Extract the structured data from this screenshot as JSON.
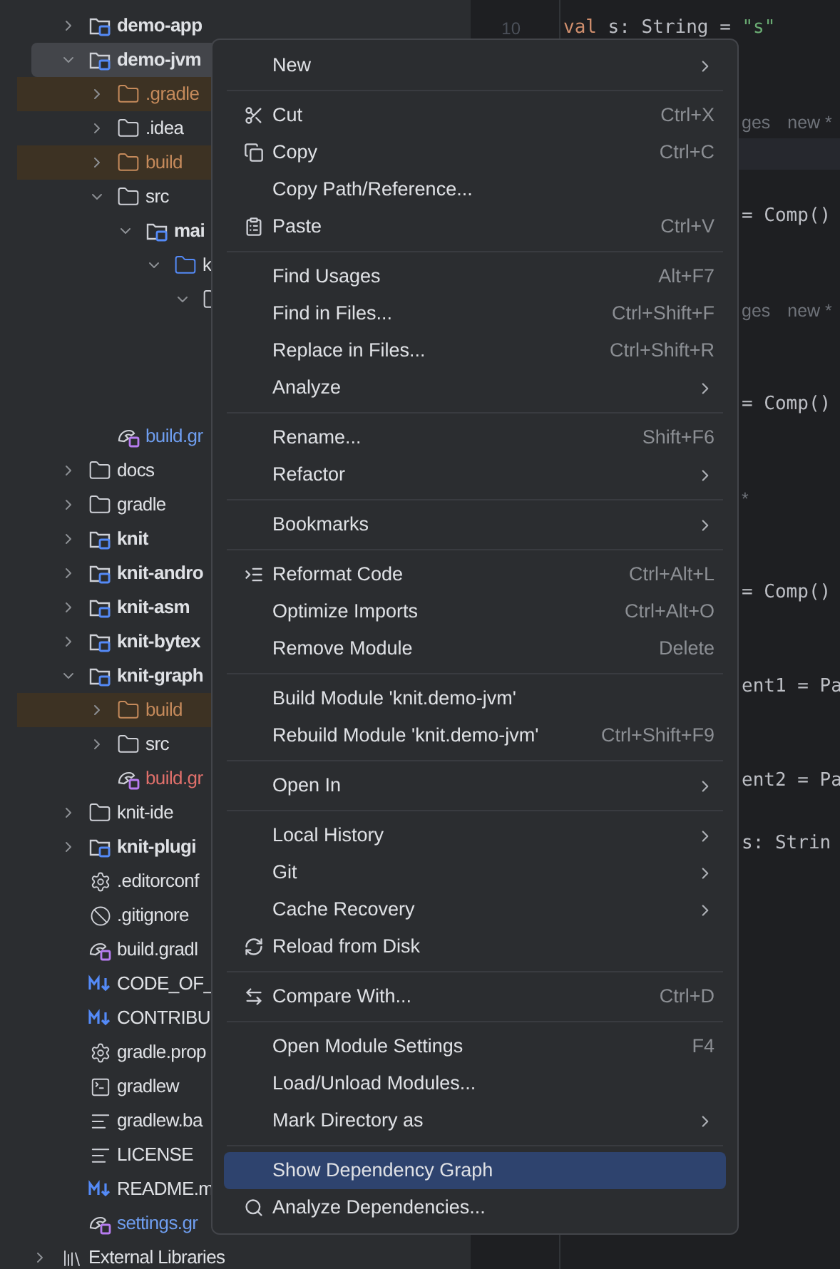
{
  "project_tree": {
    "items": [
      {
        "label": "demo-app",
        "kind": "module",
        "selected": false,
        "expanded": false
      },
      {
        "label": "demo-jvm",
        "kind": "module",
        "selected": true,
        "expanded": true,
        "children": [
          {
            "label": ".gradle",
            "kind": "excluded_folder",
            "selected": false,
            "expanded": false
          },
          {
            "label": ".idea",
            "kind": "folder",
            "selected": false,
            "expanded": false
          },
          {
            "label": "build",
            "kind": "excluded_folder",
            "selected": false,
            "expanded": false
          },
          {
            "label": "src",
            "kind": "folder",
            "selected": false,
            "expanded": true,
            "children": [
              {
                "label": "mai",
                "kind": "module",
                "selected": false,
                "expanded": true,
                "children": [
                  {
                    "label": "k",
                    "kind": "source",
                    "selected": false,
                    "expanded": true,
                    "children": [
                      {
                        "kind": "package",
                        "selected": false,
                        "expanded": true,
                        "children": [
                          {
                            "kind": "hidden"
                          },
                          {
                            "kind": "hidden"
                          },
                          {
                            "kind": "hidden"
                          }
                        ]
                      }
                    ]
                  }
                ]
              }
            ]
          },
          {
            "label": "build.gr",
            "kind": "gradle_modified",
            "selected": false
          }
        ]
      },
      {
        "label": "docs",
        "kind": "folder",
        "selected": false,
        "expanded": false
      },
      {
        "label": "gradle",
        "kind": "folder",
        "selected": false,
        "expanded": false
      },
      {
        "label": "knit",
        "kind": "module",
        "selected": false,
        "expanded": false
      },
      {
        "label": "knit-andro",
        "kind": "module",
        "selected": false,
        "expanded": false
      },
      {
        "label": "knit-asm",
        "kind": "module",
        "selected": false,
        "expanded": false
      },
      {
        "label": "knit-bytex",
        "kind": "module",
        "selected": false,
        "expanded": false
      },
      {
        "label": "knit-graph",
        "kind": "module",
        "selected": false,
        "expanded": true,
        "children": [
          {
            "label": "build",
            "kind": "excluded_folder",
            "selected": false,
            "expanded": false
          },
          {
            "label": "src",
            "kind": "folder",
            "selected": false,
            "expanded": false
          },
          {
            "label": "build.gr",
            "kind": "gradle_untracked",
            "selected": false
          }
        ]
      },
      {
        "label": "knit-ide",
        "kind": "folder",
        "selected": false,
        "expanded": false
      },
      {
        "label": "knit-plugi",
        "kind": "module",
        "selected": false,
        "expanded": false
      },
      {
        "label": ".editorconf",
        "kind": "settings",
        "selected": false
      },
      {
        "label": ".gitignore",
        "kind": "ignore",
        "selected": false
      },
      {
        "label": "build.gradl",
        "kind": "gradle",
        "selected": false
      },
      {
        "label": "CODE_OF_",
        "kind": "markdown",
        "selected": false
      },
      {
        "label": "CONTRIBU",
        "kind": "markdown",
        "selected": false
      },
      {
        "label": "gradle.prop",
        "kind": "settings",
        "selected": false
      },
      {
        "label": "gradlew",
        "kind": "terminal",
        "selected": false
      },
      {
        "label": "gradlew.ba",
        "kind": "text",
        "selected": false
      },
      {
        "label": "LICENSE",
        "kind": "text",
        "selected": false
      },
      {
        "label": "README.m",
        "kind": "markdown",
        "selected": false
      },
      {
        "label": "settings.gr",
        "kind": "gradle_modified",
        "selected": false
      }
    ],
    "external": {
      "label": "External Libraries",
      "kind": "library",
      "selected": false,
      "expanded": false
    }
  },
  "editor": {
    "lines": [
      {
        "kind": "code",
        "number": "10",
        "segments": [
          {
            "kind": "keyword",
            "text": "val"
          },
          {
            "kind": "plain",
            "text": " s: String = "
          },
          {
            "kind": "string",
            "text": "\"s\""
          }
        ]
      },
      {
        "kind": "blank"
      },
      {
        "kind": "blank"
      },
      {
        "kind": "hint",
        "hints": [
          "ges",
          "new *"
        ]
      },
      {
        "kind": "current"
      },
      {
        "kind": "blank"
      },
      {
        "kind": "fragment",
        "text": "= Comp()"
      },
      {
        "kind": "blank"
      },
      {
        "kind": "blank"
      },
      {
        "kind": "hint",
        "hints": [
          "ges",
          "new *"
        ]
      },
      {
        "kind": "blank"
      },
      {
        "kind": "blank"
      },
      {
        "kind": "fragment",
        "text": "= Comp()"
      },
      {
        "kind": "blank"
      },
      {
        "kind": "blank"
      },
      {
        "kind": "hint",
        "hints": [
          "*"
        ]
      },
      {
        "kind": "blank"
      },
      {
        "kind": "blank"
      },
      {
        "kind": "fragment",
        "text": "= Comp()"
      },
      {
        "kind": "blank"
      },
      {
        "kind": "blank"
      },
      {
        "kind": "fragment",
        "text": "ent1 = Pa"
      },
      {
        "kind": "blank"
      },
      {
        "kind": "blank"
      },
      {
        "kind": "fragment",
        "text": "ent2 = Pa"
      },
      {
        "kind": "blank"
      },
      {
        "kind": "fragment",
        "text": "s: Strin"
      }
    ]
  },
  "context_menu": {
    "items": [
      {
        "kind": "item",
        "label": "New",
        "submenu": true,
        "selected": false
      },
      {
        "kind": "separator"
      },
      {
        "kind": "item",
        "label": "Cut",
        "shortcut": "Ctrl+X",
        "selected": false
      },
      {
        "kind": "item",
        "label": "Copy",
        "shortcut": "Ctrl+C",
        "selected": false
      },
      {
        "kind": "item",
        "label": "Copy Path/Reference...",
        "selected": false
      },
      {
        "kind": "item",
        "label": "Paste",
        "shortcut": "Ctrl+V",
        "selected": false
      },
      {
        "kind": "separator"
      },
      {
        "kind": "item",
        "label": "Find Usages",
        "shortcut": "Alt+F7",
        "selected": false
      },
      {
        "kind": "item",
        "label": "Find in Files...",
        "shortcut": "Ctrl+Shift+F",
        "selected": false
      },
      {
        "kind": "item",
        "label": "Replace in Files...",
        "shortcut": "Ctrl+Shift+R",
        "selected": false
      },
      {
        "kind": "item",
        "label": "Analyze",
        "submenu": true,
        "selected": false
      },
      {
        "kind": "separator"
      },
      {
        "kind": "item",
        "label": "Rename...",
        "shortcut": "Shift+F6",
        "selected": false
      },
      {
        "kind": "item",
        "label": "Refactor",
        "submenu": true,
        "selected": false
      },
      {
        "kind": "separator"
      },
      {
        "kind": "item",
        "label": "Bookmarks",
        "submenu": true,
        "selected": false
      },
      {
        "kind": "separator"
      },
      {
        "kind": "item",
        "label": "Reformat Code",
        "shortcut": "Ctrl+Alt+L",
        "selected": false
      },
      {
        "kind": "item",
        "label": "Optimize Imports",
        "shortcut": "Ctrl+Alt+O",
        "selected": false
      },
      {
        "kind": "item",
        "label": "Remove Module",
        "shortcut": "Delete",
        "selected": false
      },
      {
        "kind": "separator"
      },
      {
        "kind": "item",
        "label": "Build Module 'knit.demo-jvm'",
        "selected": false
      },
      {
        "kind": "item",
        "label": "Rebuild Module 'knit.demo-jvm'",
        "shortcut": "Ctrl+Shift+F9",
        "selected": false
      },
      {
        "kind": "separator"
      },
      {
        "kind": "item",
        "label": "Open In",
        "submenu": true,
        "selected": false
      },
      {
        "kind": "separator"
      },
      {
        "kind": "item",
        "label": "Local History",
        "submenu": true,
        "selected": false
      },
      {
        "kind": "item",
        "label": "Git",
        "submenu": true,
        "selected": false
      },
      {
        "kind": "item",
        "label": "Cache Recovery",
        "submenu": true,
        "selected": false
      },
      {
        "kind": "item",
        "label": "Reload from Disk",
        "selected": false
      },
      {
        "kind": "separator"
      },
      {
        "kind": "item",
        "label": "Compare With...",
        "shortcut": "Ctrl+D",
        "selected": false
      },
      {
        "kind": "separator"
      },
      {
        "kind": "item",
        "label": "Open Module Settings",
        "shortcut": "F4",
        "selected": false
      },
      {
        "kind": "item",
        "label": "Load/Unload Modules...",
        "selected": false
      },
      {
        "kind": "item",
        "label": "Mark Directory as",
        "submenu": true,
        "selected": false
      },
      {
        "kind": "separator"
      },
      {
        "kind": "item",
        "label": "Show Dependency Graph",
        "selected": true
      },
      {
        "kind": "item",
        "label": "Analyze Dependencies...",
        "selected": false
      }
    ]
  }
}
